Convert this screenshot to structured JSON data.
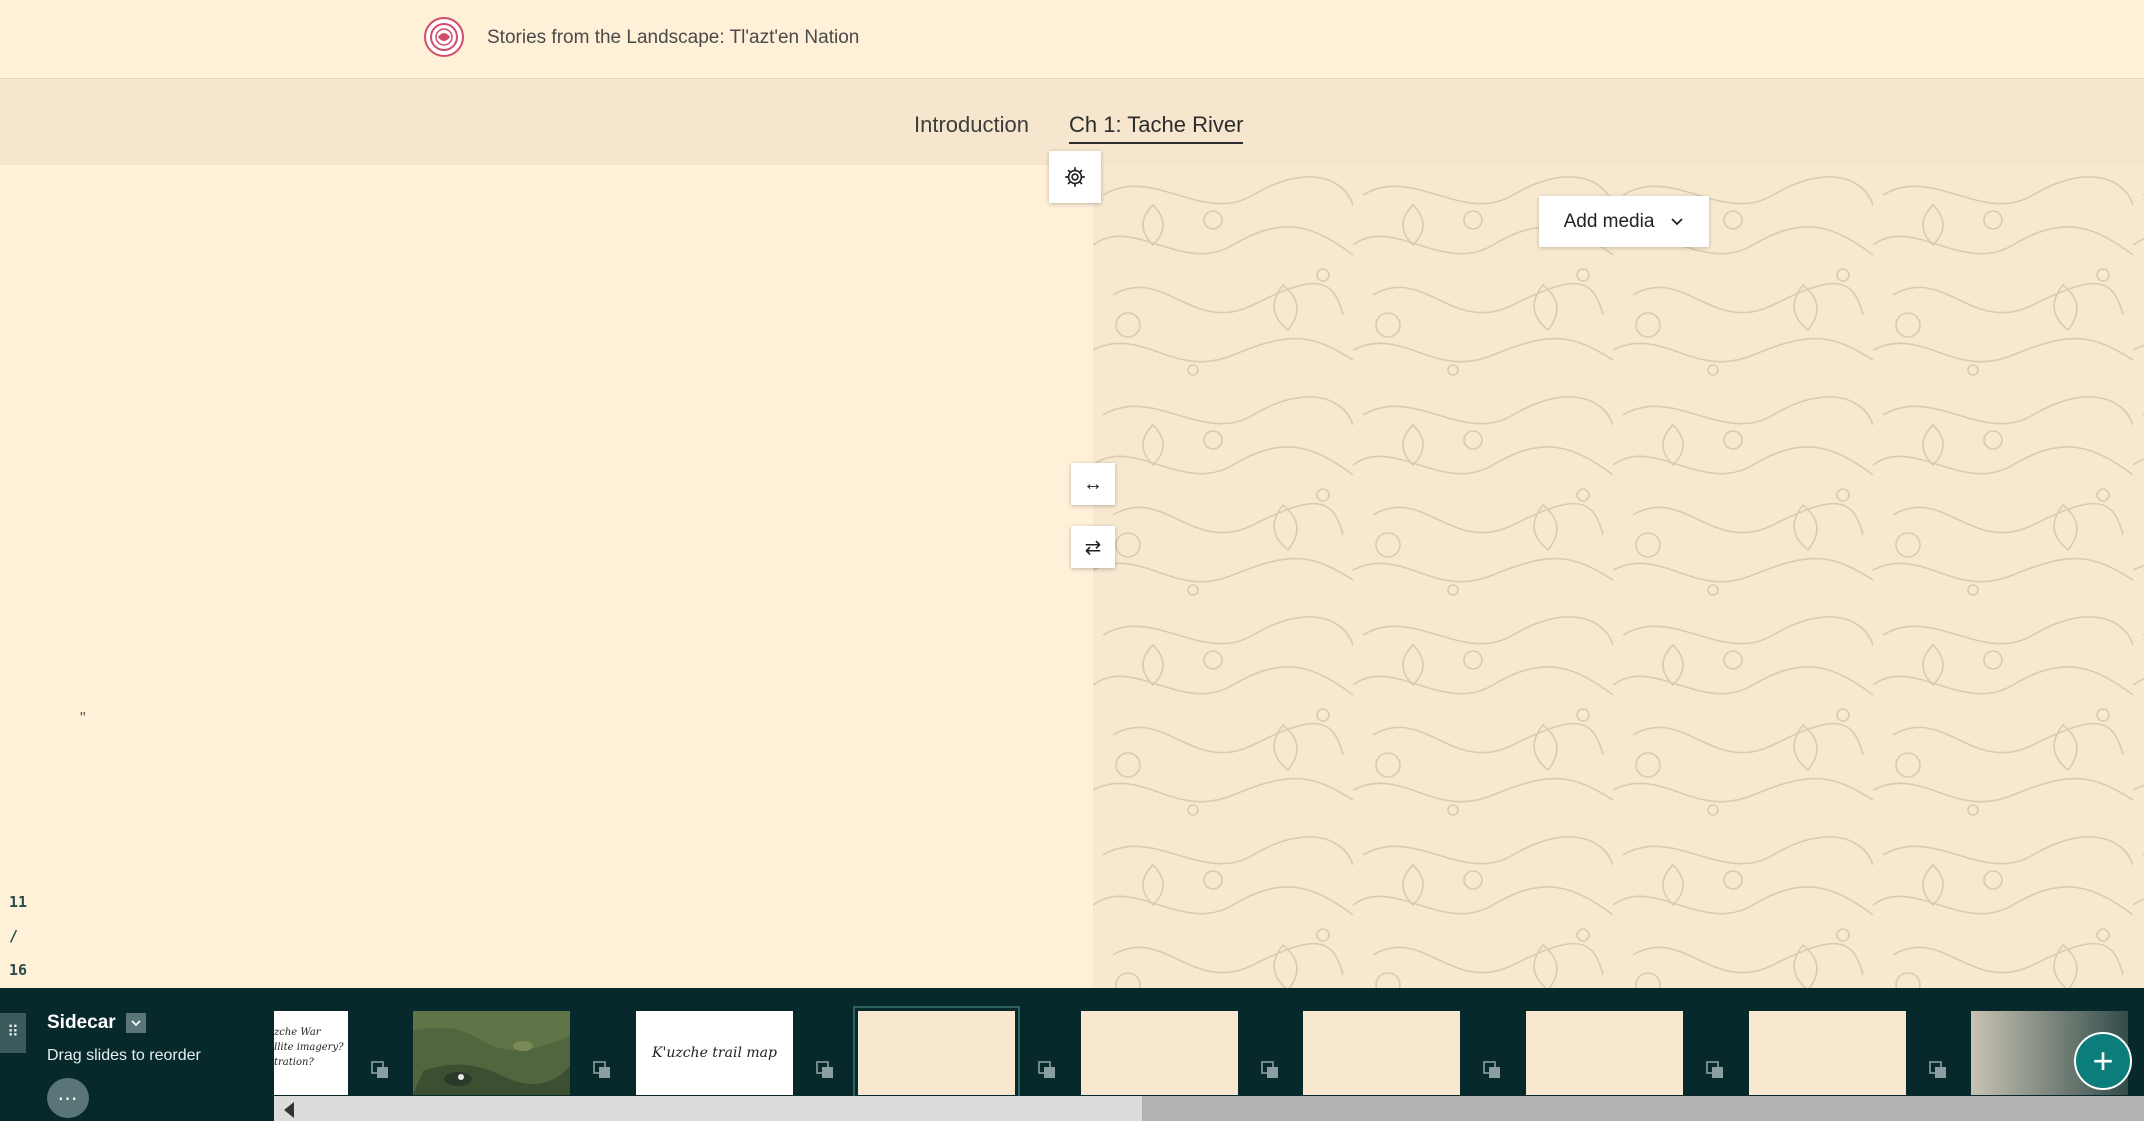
{
  "header": {
    "title": "Stories from the Landscape: Tl'azt'en Nation",
    "logo_icon": "nation-logo-icon"
  },
  "nav": {
    "items": [
      {
        "label": "Introduction",
        "active": false
      },
      {
        "label": "Ch 1: Tache River",
        "active": true
      }
    ]
  },
  "narrative": {
    "quote_mark": "\"",
    "counter": {
      "current": "11",
      "separator": "/",
      "total": "16"
    }
  },
  "media": {
    "add_media_label": "Add media",
    "background": "topographic-pattern"
  },
  "toolbar": {
    "settings_icon": "gear-icon",
    "resize_icon": "resize-horizontal-icon",
    "swap_icon": "swap-panels-icon"
  },
  "slidebar": {
    "block_label": "Sidecar",
    "hint": "Drag slides to reorder",
    "more_label": "⋯",
    "add_label": "+",
    "thumbnails": [
      {
        "text": "zche War\nllite imagery?\ntration?"
      },
      {
        "text": ""
      },
      {
        "text": "K'uzche trail map"
      },
      {
        "text": ""
      },
      {
        "text": ""
      },
      {
        "text": ""
      },
      {
        "text": ""
      },
      {
        "text": ""
      },
      {
        "text": ""
      }
    ]
  },
  "colors": {
    "background": "#fff0d8",
    "nav_bg": "#f5e6cd",
    "slidebar_bg": "#07292b",
    "accent": "#0b7d7a"
  }
}
